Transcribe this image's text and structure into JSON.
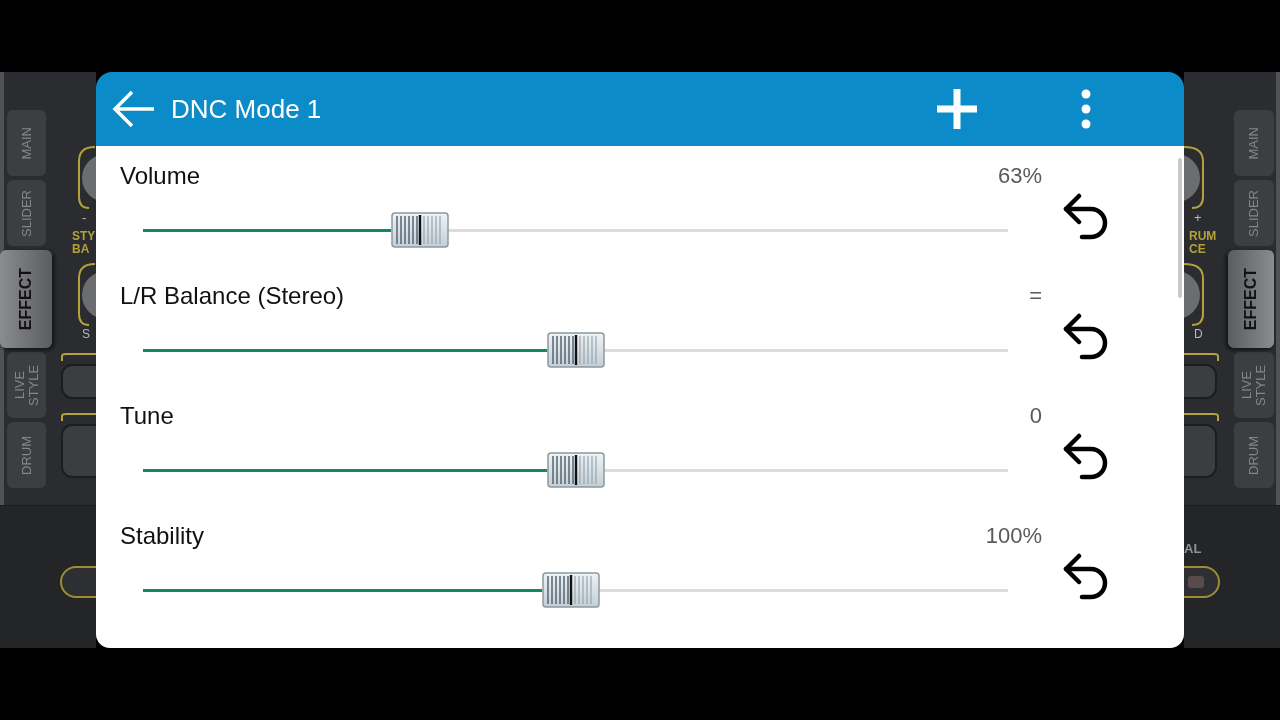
{
  "background_app": {
    "left_side": {
      "tabs": [
        {
          "label": "MAIN",
          "selected": false
        },
        {
          "label": "SLIDER",
          "selected": false
        },
        {
          "label": "EFFECT",
          "selected": true
        },
        {
          "label": "LIVE STYLE",
          "selected": false
        },
        {
          "label": "DRUM",
          "selected": false
        }
      ],
      "minus_sign": "-",
      "caption": [
        "STY",
        "BA"
      ],
      "dial_letter": "S"
    },
    "right_side": {
      "tabs": [
        {
          "label": "MAIN",
          "selected": false
        },
        {
          "label": "SLIDER",
          "selected": false
        },
        {
          "label": "EFFECT",
          "selected": true
        },
        {
          "label": "LIVE STYLE",
          "selected": false
        },
        {
          "label": "DRUM",
          "selected": false
        }
      ],
      "plus_sign": "+",
      "caption": [
        "RUM",
        "CE"
      ],
      "dial_letter": "D",
      "bottom_label": "AL"
    }
  },
  "dialog": {
    "title": "DNC Mode 1",
    "settings": [
      {
        "label": "Volume",
        "reading": "63%",
        "level": 0.32
      },
      {
        "label": "L/R Balance (Stereo)",
        "reading": "=",
        "level": 0.5
      },
      {
        "label": "Tune",
        "reading": "0",
        "level": 0.5
      },
      {
        "label": "Stability",
        "reading": "100%",
        "level": 0.495
      }
    ]
  }
}
